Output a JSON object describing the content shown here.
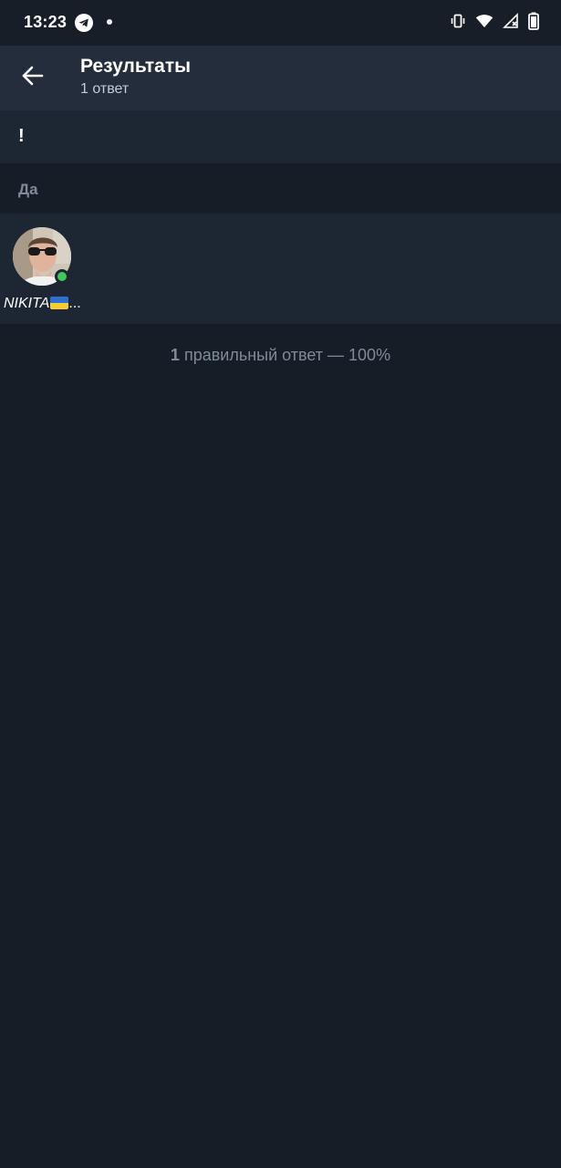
{
  "status_bar": {
    "time": "13:23",
    "icons": [
      "telegram-icon",
      "notification-dot-icon",
      "vibrate-icon",
      "wifi-icon",
      "cellular-signal-icon",
      "battery-icon"
    ]
  },
  "app_bar": {
    "title": "Результаты",
    "subtitle": "1 ответ",
    "back_icon": "arrow-left-icon"
  },
  "question": {
    "text": "!"
  },
  "option": {
    "label": "Да",
    "voters": [
      {
        "name": "NIKITA",
        "flag": "ukraine-flag-emoji",
        "truncation": "...",
        "online": true
      }
    ]
  },
  "result": {
    "count": "1",
    "text": "правильный ответ — 100%"
  },
  "colors": {
    "background": "#171d27",
    "app_bar": "#232d3c",
    "row": "#1d2633",
    "muted_text": "#7d8b9a",
    "online": "#40c95a"
  }
}
